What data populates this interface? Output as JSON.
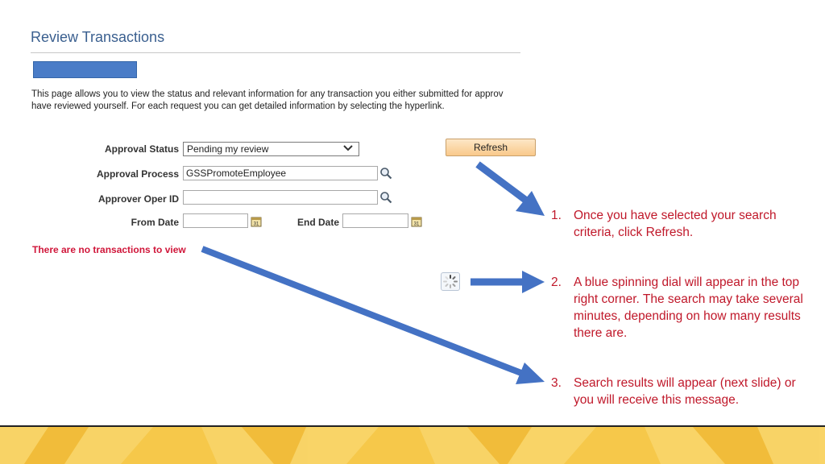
{
  "page": {
    "title": "Review Transactions",
    "description_line1": "This page allows you to view the status and relevant information for any transaction you either submitted for approv",
    "description_line2": "have reviewed yourself. For each request you can get detailed information by selecting the hyperlink."
  },
  "form": {
    "approval_status_label": "Approval Status",
    "approval_status_value": "Pending my review",
    "approval_process_label": "Approval Process",
    "approval_process_value": "GSSPromoteEmployee",
    "approver_oper_id_label": "Approver Oper ID",
    "approver_oper_id_value": "",
    "from_date_label": "From Date",
    "from_date_value": "",
    "end_date_label": "End Date",
    "end_date_value": "",
    "refresh_label": "Refresh"
  },
  "message": "There are no transactions to view",
  "annotations": [
    {
      "number": "1.",
      "text": "Once you have selected your search criteria, click Refresh."
    },
    {
      "number": "2.",
      "text": "A blue spinning dial will appear in the top right corner. The search may take several minutes, depending on how many results there are."
    },
    {
      "number": "3.",
      "text": "Search results will appear (next slide) or you will receive this message."
    }
  ],
  "colors": {
    "arrow": "#4472c4",
    "annotation_text": "#c0182a",
    "error_text": "#d0163a",
    "footer": "#f6c84a"
  },
  "icons": {
    "lookup": "magnifier-icon",
    "calendar": "calendar-icon",
    "spinner": "spinner-icon"
  }
}
